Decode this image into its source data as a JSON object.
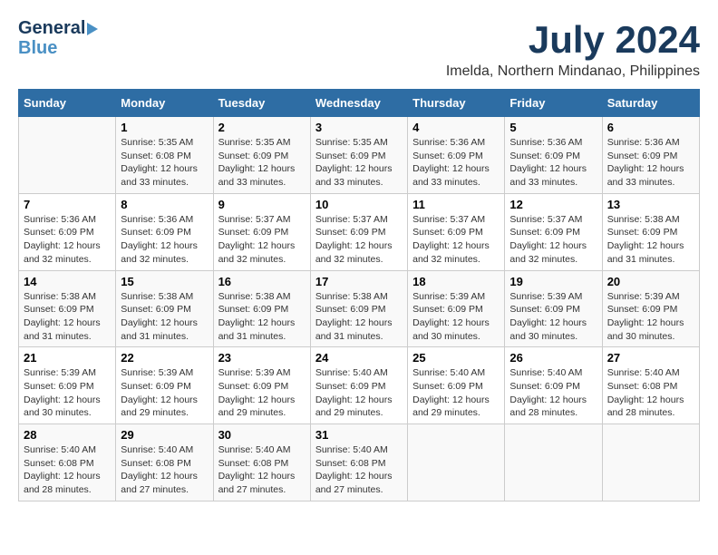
{
  "logo": {
    "line1": "General",
    "line2": "Blue"
  },
  "title": "July 2024",
  "subtitle": "Imelda, Northern Mindanao, Philippines",
  "days_of_week": [
    "Sunday",
    "Monday",
    "Tuesday",
    "Wednesday",
    "Thursday",
    "Friday",
    "Saturday"
  ],
  "weeks": [
    [
      {
        "num": "",
        "info": ""
      },
      {
        "num": "1",
        "info": "Sunrise: 5:35 AM\nSunset: 6:08 PM\nDaylight: 12 hours\nand 33 minutes."
      },
      {
        "num": "2",
        "info": "Sunrise: 5:35 AM\nSunset: 6:09 PM\nDaylight: 12 hours\nand 33 minutes."
      },
      {
        "num": "3",
        "info": "Sunrise: 5:35 AM\nSunset: 6:09 PM\nDaylight: 12 hours\nand 33 minutes."
      },
      {
        "num": "4",
        "info": "Sunrise: 5:36 AM\nSunset: 6:09 PM\nDaylight: 12 hours\nand 33 minutes."
      },
      {
        "num": "5",
        "info": "Sunrise: 5:36 AM\nSunset: 6:09 PM\nDaylight: 12 hours\nand 33 minutes."
      },
      {
        "num": "6",
        "info": "Sunrise: 5:36 AM\nSunset: 6:09 PM\nDaylight: 12 hours\nand 33 minutes."
      }
    ],
    [
      {
        "num": "7",
        "info": "Sunrise: 5:36 AM\nSunset: 6:09 PM\nDaylight: 12 hours\nand 32 minutes."
      },
      {
        "num": "8",
        "info": "Sunrise: 5:36 AM\nSunset: 6:09 PM\nDaylight: 12 hours\nand 32 minutes."
      },
      {
        "num": "9",
        "info": "Sunrise: 5:37 AM\nSunset: 6:09 PM\nDaylight: 12 hours\nand 32 minutes."
      },
      {
        "num": "10",
        "info": "Sunrise: 5:37 AM\nSunset: 6:09 PM\nDaylight: 12 hours\nand 32 minutes."
      },
      {
        "num": "11",
        "info": "Sunrise: 5:37 AM\nSunset: 6:09 PM\nDaylight: 12 hours\nand 32 minutes."
      },
      {
        "num": "12",
        "info": "Sunrise: 5:37 AM\nSunset: 6:09 PM\nDaylight: 12 hours\nand 32 minutes."
      },
      {
        "num": "13",
        "info": "Sunrise: 5:38 AM\nSunset: 6:09 PM\nDaylight: 12 hours\nand 31 minutes."
      }
    ],
    [
      {
        "num": "14",
        "info": "Sunrise: 5:38 AM\nSunset: 6:09 PM\nDaylight: 12 hours\nand 31 minutes."
      },
      {
        "num": "15",
        "info": "Sunrise: 5:38 AM\nSunset: 6:09 PM\nDaylight: 12 hours\nand 31 minutes."
      },
      {
        "num": "16",
        "info": "Sunrise: 5:38 AM\nSunset: 6:09 PM\nDaylight: 12 hours\nand 31 minutes."
      },
      {
        "num": "17",
        "info": "Sunrise: 5:38 AM\nSunset: 6:09 PM\nDaylight: 12 hours\nand 31 minutes."
      },
      {
        "num": "18",
        "info": "Sunrise: 5:39 AM\nSunset: 6:09 PM\nDaylight: 12 hours\nand 30 minutes."
      },
      {
        "num": "19",
        "info": "Sunrise: 5:39 AM\nSunset: 6:09 PM\nDaylight: 12 hours\nand 30 minutes."
      },
      {
        "num": "20",
        "info": "Sunrise: 5:39 AM\nSunset: 6:09 PM\nDaylight: 12 hours\nand 30 minutes."
      }
    ],
    [
      {
        "num": "21",
        "info": "Sunrise: 5:39 AM\nSunset: 6:09 PM\nDaylight: 12 hours\nand 30 minutes."
      },
      {
        "num": "22",
        "info": "Sunrise: 5:39 AM\nSunset: 6:09 PM\nDaylight: 12 hours\nand 29 minutes."
      },
      {
        "num": "23",
        "info": "Sunrise: 5:39 AM\nSunset: 6:09 PM\nDaylight: 12 hours\nand 29 minutes."
      },
      {
        "num": "24",
        "info": "Sunrise: 5:40 AM\nSunset: 6:09 PM\nDaylight: 12 hours\nand 29 minutes."
      },
      {
        "num": "25",
        "info": "Sunrise: 5:40 AM\nSunset: 6:09 PM\nDaylight: 12 hours\nand 29 minutes."
      },
      {
        "num": "26",
        "info": "Sunrise: 5:40 AM\nSunset: 6:09 PM\nDaylight: 12 hours\nand 28 minutes."
      },
      {
        "num": "27",
        "info": "Sunrise: 5:40 AM\nSunset: 6:08 PM\nDaylight: 12 hours\nand 28 minutes."
      }
    ],
    [
      {
        "num": "28",
        "info": "Sunrise: 5:40 AM\nSunset: 6:08 PM\nDaylight: 12 hours\nand 28 minutes."
      },
      {
        "num": "29",
        "info": "Sunrise: 5:40 AM\nSunset: 6:08 PM\nDaylight: 12 hours\nand 27 minutes."
      },
      {
        "num": "30",
        "info": "Sunrise: 5:40 AM\nSunset: 6:08 PM\nDaylight: 12 hours\nand 27 minutes."
      },
      {
        "num": "31",
        "info": "Sunrise: 5:40 AM\nSunset: 6:08 PM\nDaylight: 12 hours\nand 27 minutes."
      },
      {
        "num": "",
        "info": ""
      },
      {
        "num": "",
        "info": ""
      },
      {
        "num": "",
        "info": ""
      }
    ]
  ]
}
